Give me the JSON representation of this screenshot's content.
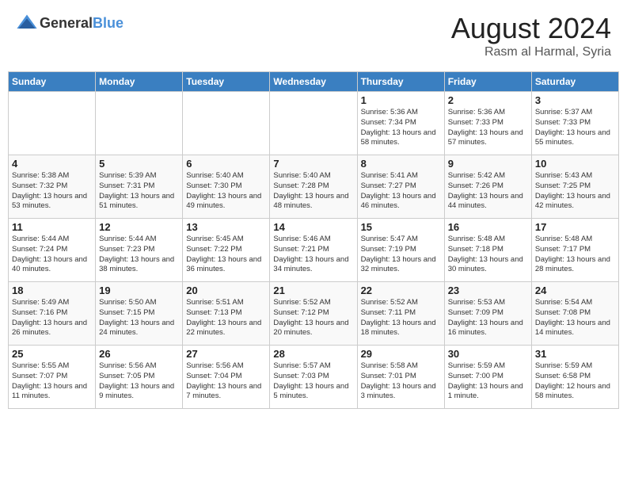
{
  "header": {
    "logo_general": "General",
    "logo_blue": "Blue",
    "title": "August 2024",
    "subtitle": "Rasm al Harmal, Syria"
  },
  "days_of_week": [
    "Sunday",
    "Monday",
    "Tuesday",
    "Wednesday",
    "Thursday",
    "Friday",
    "Saturday"
  ],
  "weeks": [
    [
      {
        "day": "",
        "content": ""
      },
      {
        "day": "",
        "content": ""
      },
      {
        "day": "",
        "content": ""
      },
      {
        "day": "",
        "content": ""
      },
      {
        "day": "1",
        "content": "Sunrise: 5:36 AM\nSunset: 7:34 PM\nDaylight: 13 hours\nand 58 minutes."
      },
      {
        "day": "2",
        "content": "Sunrise: 5:36 AM\nSunset: 7:33 PM\nDaylight: 13 hours\nand 57 minutes."
      },
      {
        "day": "3",
        "content": "Sunrise: 5:37 AM\nSunset: 7:33 PM\nDaylight: 13 hours\nand 55 minutes."
      }
    ],
    [
      {
        "day": "4",
        "content": "Sunrise: 5:38 AM\nSunset: 7:32 PM\nDaylight: 13 hours\nand 53 minutes."
      },
      {
        "day": "5",
        "content": "Sunrise: 5:39 AM\nSunset: 7:31 PM\nDaylight: 13 hours\nand 51 minutes."
      },
      {
        "day": "6",
        "content": "Sunrise: 5:40 AM\nSunset: 7:30 PM\nDaylight: 13 hours\nand 49 minutes."
      },
      {
        "day": "7",
        "content": "Sunrise: 5:40 AM\nSunset: 7:28 PM\nDaylight: 13 hours\nand 48 minutes."
      },
      {
        "day": "8",
        "content": "Sunrise: 5:41 AM\nSunset: 7:27 PM\nDaylight: 13 hours\nand 46 minutes."
      },
      {
        "day": "9",
        "content": "Sunrise: 5:42 AM\nSunset: 7:26 PM\nDaylight: 13 hours\nand 44 minutes."
      },
      {
        "day": "10",
        "content": "Sunrise: 5:43 AM\nSunset: 7:25 PM\nDaylight: 13 hours\nand 42 minutes."
      }
    ],
    [
      {
        "day": "11",
        "content": "Sunrise: 5:44 AM\nSunset: 7:24 PM\nDaylight: 13 hours\nand 40 minutes."
      },
      {
        "day": "12",
        "content": "Sunrise: 5:44 AM\nSunset: 7:23 PM\nDaylight: 13 hours\nand 38 minutes."
      },
      {
        "day": "13",
        "content": "Sunrise: 5:45 AM\nSunset: 7:22 PM\nDaylight: 13 hours\nand 36 minutes."
      },
      {
        "day": "14",
        "content": "Sunrise: 5:46 AM\nSunset: 7:21 PM\nDaylight: 13 hours\nand 34 minutes."
      },
      {
        "day": "15",
        "content": "Sunrise: 5:47 AM\nSunset: 7:19 PM\nDaylight: 13 hours\nand 32 minutes."
      },
      {
        "day": "16",
        "content": "Sunrise: 5:48 AM\nSunset: 7:18 PM\nDaylight: 13 hours\nand 30 minutes."
      },
      {
        "day": "17",
        "content": "Sunrise: 5:48 AM\nSunset: 7:17 PM\nDaylight: 13 hours\nand 28 minutes."
      }
    ],
    [
      {
        "day": "18",
        "content": "Sunrise: 5:49 AM\nSunset: 7:16 PM\nDaylight: 13 hours\nand 26 minutes."
      },
      {
        "day": "19",
        "content": "Sunrise: 5:50 AM\nSunset: 7:15 PM\nDaylight: 13 hours\nand 24 minutes."
      },
      {
        "day": "20",
        "content": "Sunrise: 5:51 AM\nSunset: 7:13 PM\nDaylight: 13 hours\nand 22 minutes."
      },
      {
        "day": "21",
        "content": "Sunrise: 5:52 AM\nSunset: 7:12 PM\nDaylight: 13 hours\nand 20 minutes."
      },
      {
        "day": "22",
        "content": "Sunrise: 5:52 AM\nSunset: 7:11 PM\nDaylight: 13 hours\nand 18 minutes."
      },
      {
        "day": "23",
        "content": "Sunrise: 5:53 AM\nSunset: 7:09 PM\nDaylight: 13 hours\nand 16 minutes."
      },
      {
        "day": "24",
        "content": "Sunrise: 5:54 AM\nSunset: 7:08 PM\nDaylight: 13 hours\nand 14 minutes."
      }
    ],
    [
      {
        "day": "25",
        "content": "Sunrise: 5:55 AM\nSunset: 7:07 PM\nDaylight: 13 hours\nand 11 minutes."
      },
      {
        "day": "26",
        "content": "Sunrise: 5:56 AM\nSunset: 7:05 PM\nDaylight: 13 hours\nand 9 minutes."
      },
      {
        "day": "27",
        "content": "Sunrise: 5:56 AM\nSunset: 7:04 PM\nDaylight: 13 hours\nand 7 minutes."
      },
      {
        "day": "28",
        "content": "Sunrise: 5:57 AM\nSunset: 7:03 PM\nDaylight: 13 hours\nand 5 minutes."
      },
      {
        "day": "29",
        "content": "Sunrise: 5:58 AM\nSunset: 7:01 PM\nDaylight: 13 hours\nand 3 minutes."
      },
      {
        "day": "30",
        "content": "Sunrise: 5:59 AM\nSunset: 7:00 PM\nDaylight: 13 hours\nand 1 minute."
      },
      {
        "day": "31",
        "content": "Sunrise: 5:59 AM\nSunset: 6:58 PM\nDaylight: 12 hours\nand 58 minutes."
      }
    ]
  ]
}
